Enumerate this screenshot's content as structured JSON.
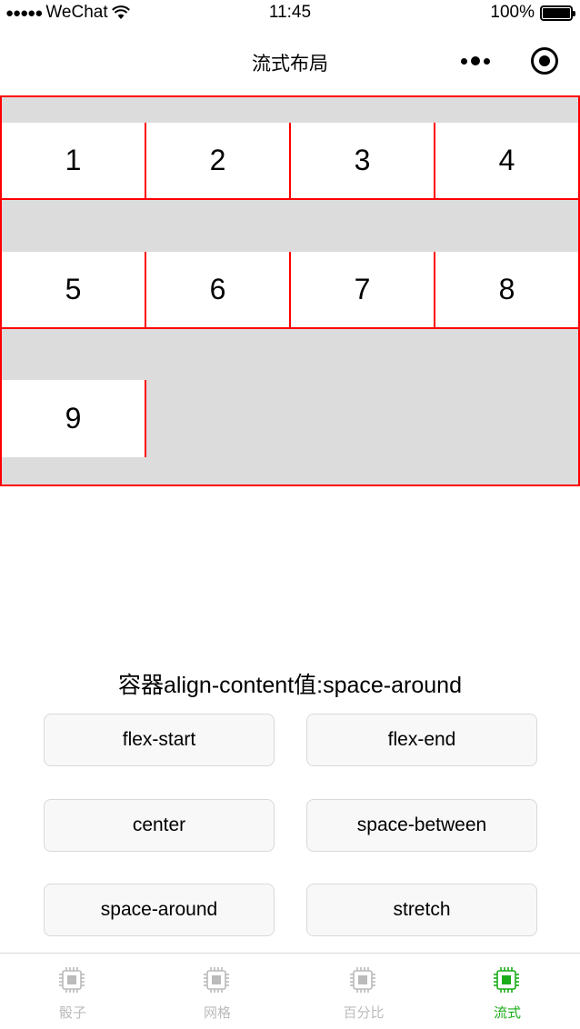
{
  "status_bar": {
    "signal": "●●●●●",
    "carrier": "WeChat",
    "time": "11:45",
    "battery_percent": "100%"
  },
  "nav": {
    "title": "流式布局"
  },
  "flex_items": [
    "1",
    "2",
    "3",
    "4",
    "5",
    "6",
    "7",
    "8",
    "9"
  ],
  "property_label": "容器align-content值:space-around",
  "options": {
    "flex_start": "flex-start",
    "flex_end": "flex-end",
    "center": "center",
    "space_between": "space-between",
    "space_around": "space-around",
    "stretch": "stretch"
  },
  "tabs": [
    {
      "label": "骰子",
      "icon": "chip-icon"
    },
    {
      "label": "网格",
      "icon": "chip-icon"
    },
    {
      "label": "百分比",
      "icon": "chip-icon"
    },
    {
      "label": "流式",
      "icon": "chip-icon"
    }
  ],
  "active_tab": "流式",
  "colors": {
    "container_border": "#ff0000",
    "container_bg": "#dcdcdc",
    "tab_active": "#1aad19",
    "tab_inactive": "#bbbbbb"
  }
}
